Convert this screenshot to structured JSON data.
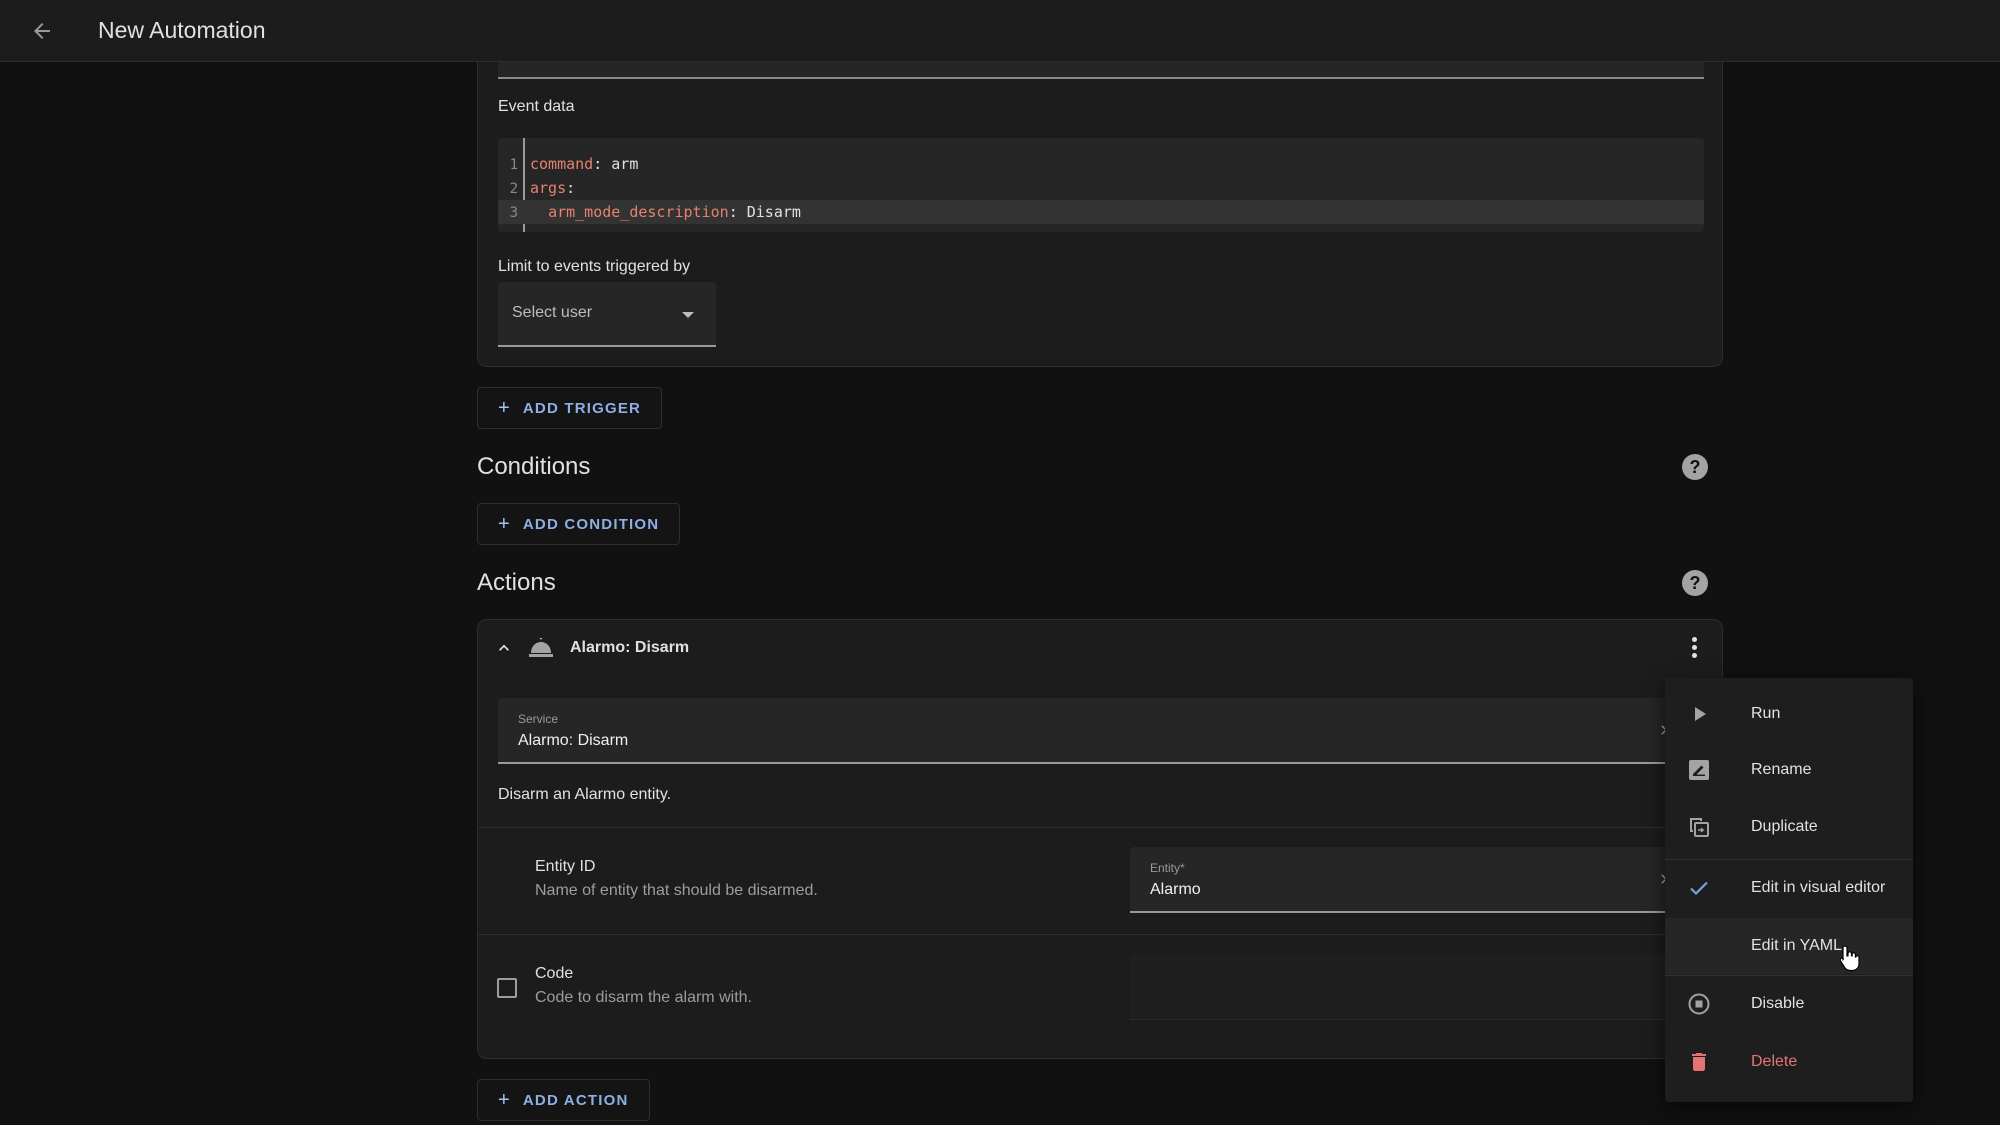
{
  "header": {
    "back_icon": "arrow-left-icon",
    "title": "New Automation"
  },
  "trigger": {
    "event_data_label": "Event data",
    "code_lines": [
      {
        "num": "1",
        "key": "command",
        "sep": ": ",
        "value": "arm",
        "indent": ""
      },
      {
        "num": "2",
        "key": "args",
        "sep": ":",
        "value": "",
        "indent": ""
      },
      {
        "num": "3",
        "key": "arm_mode_description",
        "sep": ": ",
        "value": "Disarm",
        "indent": "  "
      }
    ],
    "limit_label": "Limit to events triggered by",
    "select_user_placeholder": "Select user"
  },
  "buttons": {
    "add_trigger": "ADD TRIGGER",
    "add_condition": "ADD CONDITION",
    "add_action": "ADD ACTION",
    "plus": "+"
  },
  "sections": {
    "conditions": "Conditions",
    "actions": "Actions",
    "help": "?"
  },
  "action": {
    "title": "Alarmo: Disarm",
    "icon": "bell-icon",
    "service_label": "Service",
    "service_value": "Alarmo: Disarm",
    "description": "Disarm an Alarmo entity.",
    "fields": [
      {
        "title": "Entity ID",
        "desc": "Name of entity that should be disarmed.",
        "input_label": "Entity*",
        "input_value": "Alarmo"
      },
      {
        "title": "Code",
        "desc": "Code to disarm the alarm with.",
        "checked": false
      }
    ]
  },
  "menu": {
    "items": [
      {
        "label": "Run",
        "icon": "play-icon"
      },
      {
        "label": "Rename",
        "icon": "rename-icon"
      },
      {
        "label": "Duplicate",
        "icon": "duplicate-icon"
      },
      {
        "label": "Edit in visual editor",
        "icon": "check-icon",
        "checked": true
      },
      {
        "label": "Edit in YAML",
        "icon": "",
        "hovered": true
      },
      {
        "label": "Disable",
        "icon": "stop-circle-icon"
      },
      {
        "label": "Delete",
        "icon": "delete-icon",
        "danger": true
      }
    ]
  },
  "colors": {
    "accent": "#8eaee6",
    "danger": "#e57373",
    "check": "#7a9fe0",
    "yaml_key": "#e5826e"
  }
}
